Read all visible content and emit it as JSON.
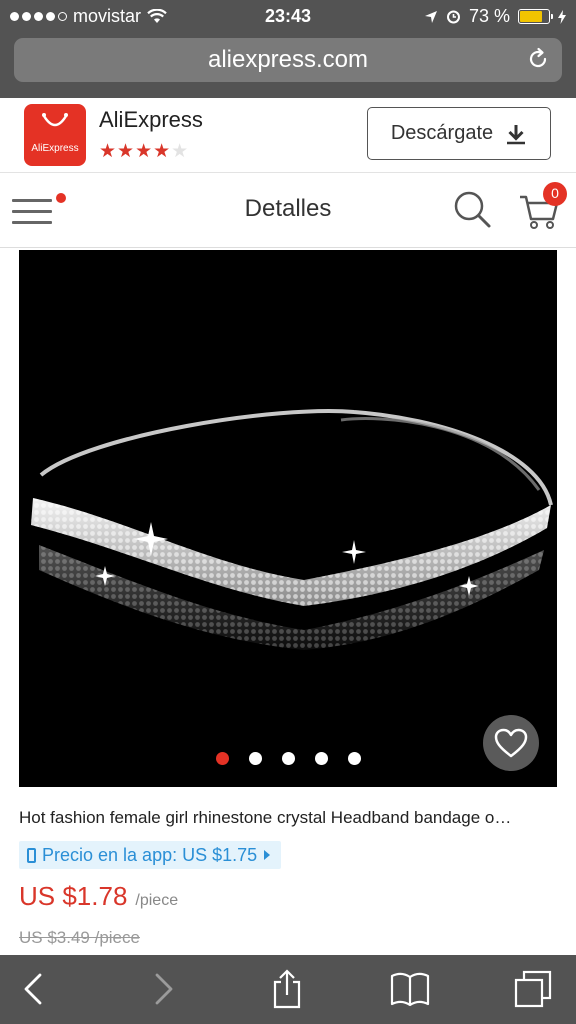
{
  "status_bar": {
    "carrier": "movistar",
    "time": "23:43",
    "battery": "73 %"
  },
  "browser": {
    "url": "aliexpress.com"
  },
  "app_banner": {
    "name": "AliExpress",
    "logo_text": "AliExpress",
    "rating": 4.5,
    "download_label": "Descárgate"
  },
  "header": {
    "title": "Detalles",
    "cart_count": "0"
  },
  "product": {
    "title": "Hot fashion female girl rhinestone crystal Headband bandage o…",
    "app_price": "Precio en la app: US $1.75",
    "price": "US $1.78",
    "unit": "/piece",
    "old_price": "US $3.49 /piece",
    "image_count": 5,
    "active_image": 1
  },
  "colors": {
    "brand": "#e43225",
    "link": "#2a8fd6",
    "browser_chrome": "#535353"
  }
}
